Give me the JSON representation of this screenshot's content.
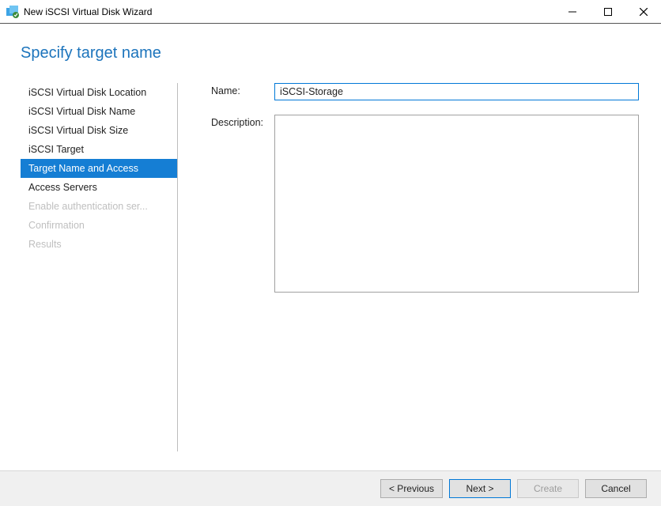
{
  "window": {
    "title": "New iSCSI Virtual Disk Wizard"
  },
  "header": {
    "title": "Specify target name"
  },
  "sidebar": {
    "items": [
      {
        "label": "iSCSI Virtual Disk Location",
        "state": "normal"
      },
      {
        "label": "iSCSI Virtual Disk Name",
        "state": "normal"
      },
      {
        "label": "iSCSI Virtual Disk Size",
        "state": "normal"
      },
      {
        "label": "iSCSI Target",
        "state": "normal"
      },
      {
        "label": "Target Name and Access",
        "state": "active"
      },
      {
        "label": "Access Servers",
        "state": "normal"
      },
      {
        "label": "Enable authentication ser...",
        "state": "disabled"
      },
      {
        "label": "Confirmation",
        "state": "disabled"
      },
      {
        "label": "Results",
        "state": "disabled"
      }
    ]
  },
  "form": {
    "name_label": "Name:",
    "name_value": "iSCSI-Storage",
    "description_label": "Description:",
    "description_value": ""
  },
  "footer": {
    "previous": "< Previous",
    "next": "Next >",
    "create": "Create",
    "cancel": "Cancel"
  }
}
